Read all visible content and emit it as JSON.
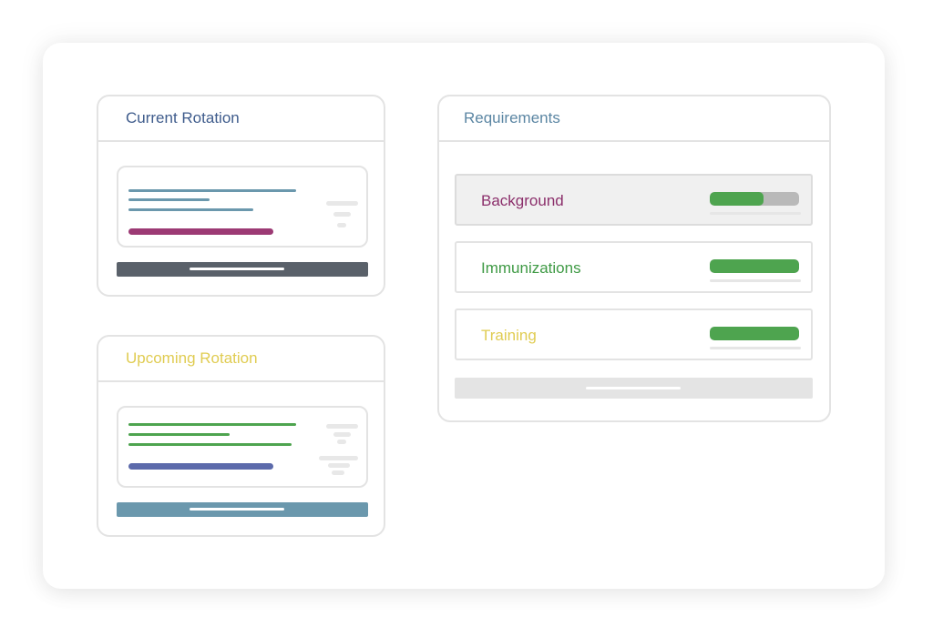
{
  "current_rotation": {
    "title": "Current Rotation",
    "title_color": "#3f5c8c",
    "line_color": "#6b98ad",
    "highlight_color": "#9c3a74",
    "footer_color": "#5a616a"
  },
  "upcoming_rotation": {
    "title": "Upcoming Rotation",
    "title_color": "#e0cc52",
    "line_color": "#4ea44f",
    "highlight_color": "#5c6aab",
    "footer_color": "#6b98ad"
  },
  "requirements": {
    "title": "Requirements",
    "title_color": "#5b86a3",
    "items": [
      {
        "label": "Background",
        "color": "#8b2f6b",
        "progress": 0.6,
        "active": true
      },
      {
        "label": "Immunizations",
        "color": "#3f9a45",
        "progress": 1.0,
        "active": false
      },
      {
        "label": "Training",
        "color": "#e0cc52",
        "progress": 1.0,
        "active": false
      }
    ]
  }
}
